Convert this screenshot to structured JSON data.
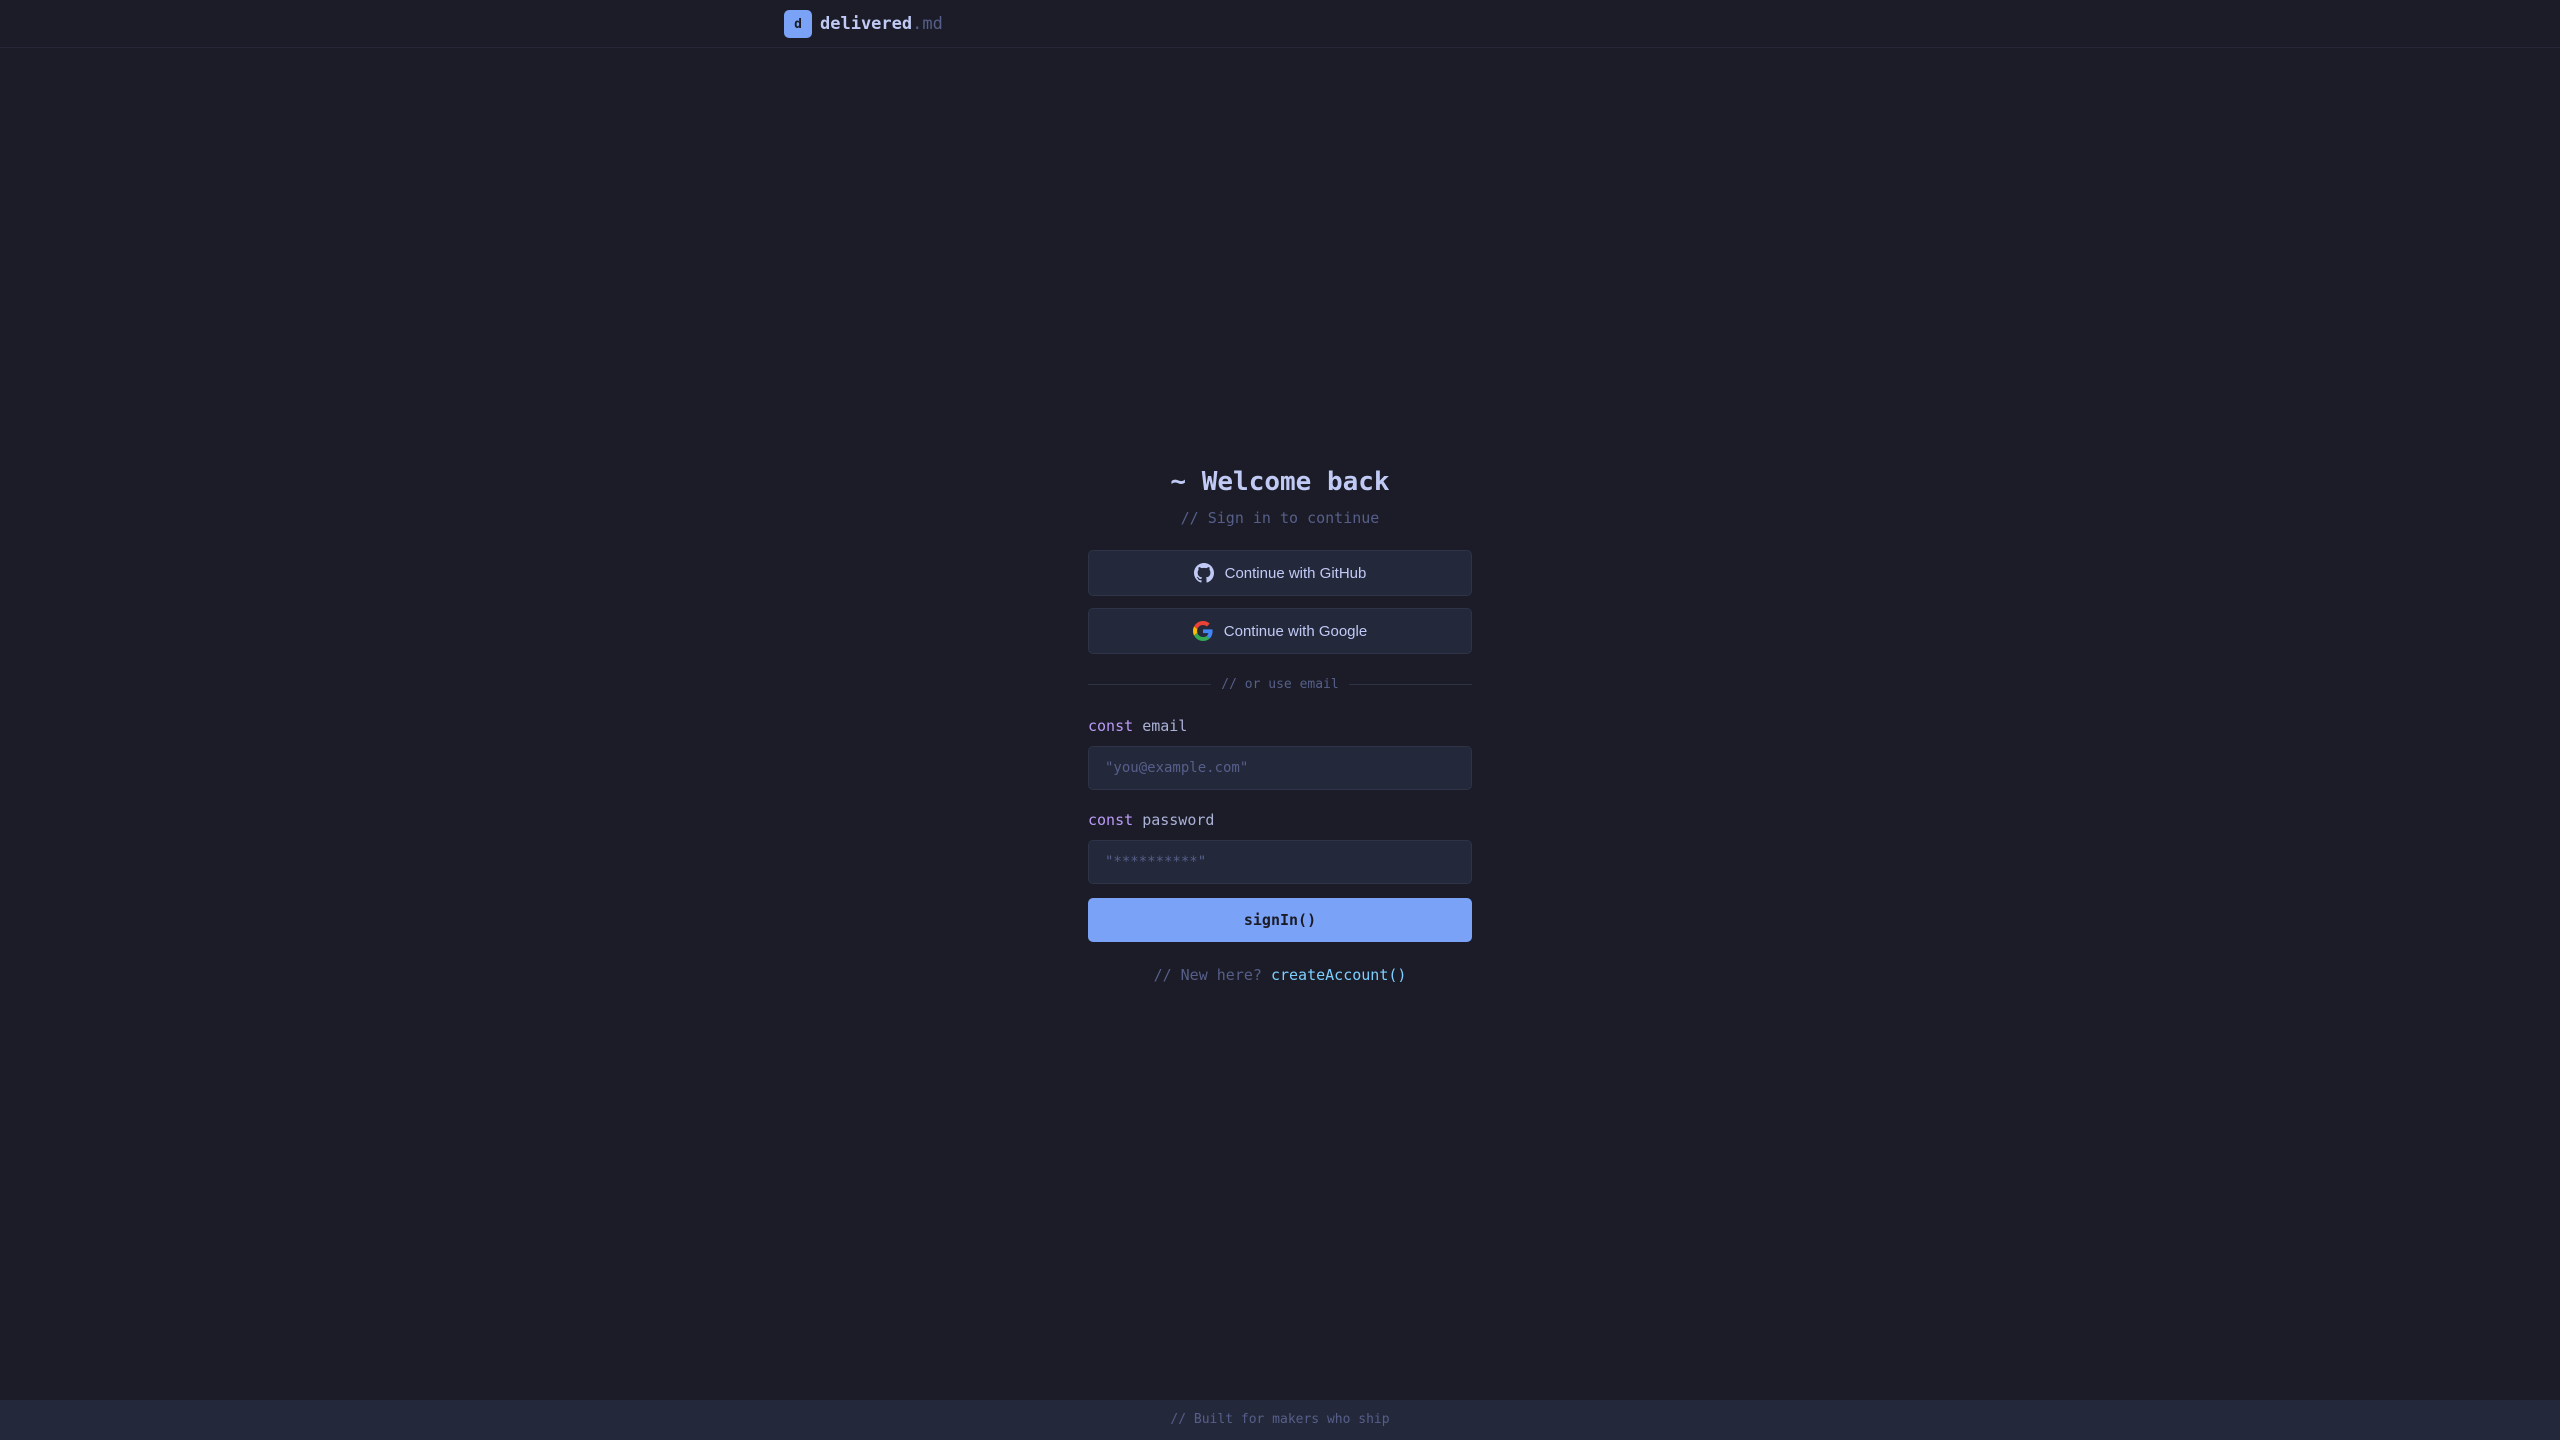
{
  "header": {
    "logo_letter": "d",
    "brand_name": "delivered",
    "brand_ext": ".md"
  },
  "login": {
    "title": "~ Welcome back",
    "subtitle": "// Sign in to continue",
    "github_label": "Continue with GitHub",
    "google_label": "Continue with Google",
    "divider_text": "// or use email",
    "email": {
      "keyword": "const",
      "name": "email",
      "placeholder": "\"you@example.com\"",
      "value": ""
    },
    "password": {
      "keyword": "const",
      "name": "password",
      "placeholder": "\"**********\"",
      "value": ""
    },
    "submit_label": "signIn()",
    "signup_prompt": "// New here?",
    "signup_link": "createAccount()"
  },
  "footer": {
    "text": "// Built for makers who ship"
  },
  "colors": {
    "background": "#1b1c27",
    "accent": "#7aa2f7",
    "keyword": "#bb9af7",
    "link": "#7dcfff"
  },
  "icons": {
    "github": "github-icon",
    "google": "google-icon"
  }
}
